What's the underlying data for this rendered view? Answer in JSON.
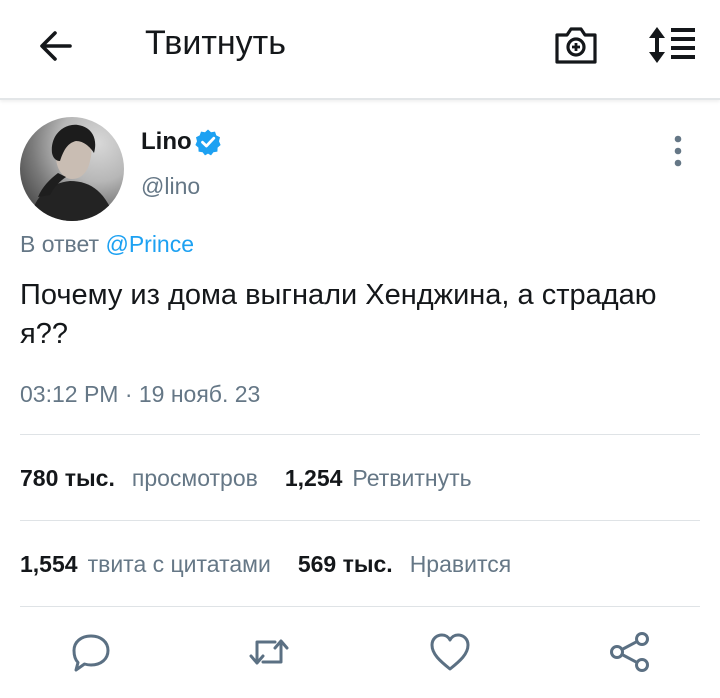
{
  "header": {
    "title": "Твитнуть",
    "back_icon": "arrow-left-icon",
    "camera_icon": "camera-icon",
    "sort_icon": "sort-list-icon"
  },
  "tweet": {
    "author": {
      "name": "Lino",
      "handle": "@lino",
      "verified": true,
      "verified_color": "#1da1f2"
    },
    "reply_prefix": "В ответ",
    "reply_to": "@Prince",
    "text": "Почему из дома выгнали Хенджина, а страдаю я??",
    "timestamp": "03:12 PM · 19 нояб. 23"
  },
  "stats": {
    "views_count": "780 тыс.",
    "views_label": "просмотров",
    "retweets_count": "1,254",
    "retweets_label": "Ретвитнуть",
    "quotes_count": "1,554",
    "quotes_label": "твита с цитатами",
    "likes_count": "569 тыс.",
    "likes_label": "Нравится"
  },
  "actions": [
    "reply-icon",
    "retweet-icon",
    "like-icon",
    "share-icon"
  ],
  "colors": {
    "accent": "#1da1f2",
    "text": "#14171a",
    "secondary": "#657786",
    "icon": "#5b7083"
  }
}
